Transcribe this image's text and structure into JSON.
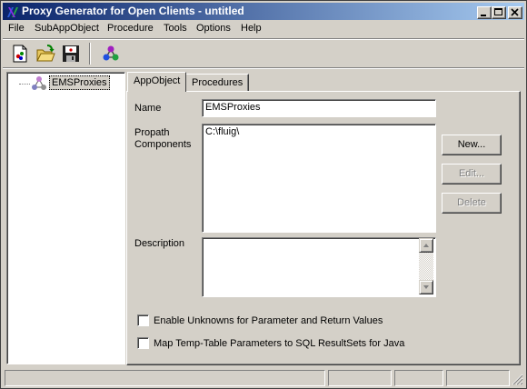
{
  "window": {
    "title": "Proxy Generator for Open Clients - untitled",
    "controls": [
      "minimize",
      "maximize",
      "close"
    ]
  },
  "menu": {
    "items": [
      {
        "label": "File"
      },
      {
        "label": "SubAppObject"
      },
      {
        "label": "Procedure"
      },
      {
        "label": "Tools"
      },
      {
        "label": "Options"
      },
      {
        "label": "Help"
      }
    ]
  },
  "toolbar": {
    "buttons": [
      {
        "icon": "new-document-icon"
      },
      {
        "icon": "open-folder-icon"
      },
      {
        "icon": "save-disk-icon"
      },
      {
        "icon": "generate-proxy-icon"
      }
    ]
  },
  "tree": {
    "root": {
      "label": "EMSProxies",
      "icon": "appobject-node-icon"
    }
  },
  "tabs": [
    {
      "label": "AppObject",
      "active": true
    },
    {
      "label": "Procedures",
      "active": false
    }
  ],
  "form": {
    "name_label": "Name",
    "name_value": "EMSProxies",
    "propath_label_line1": "Propath",
    "propath_label_line2": "Components",
    "propath_value": "C:\\fluig\\",
    "description_label": "Description",
    "description_value": "",
    "new_button": "New...",
    "edit_button": "Edit...",
    "delete_button": "Delete",
    "checkbox_unknowns": {
      "label": "Enable Unknowns for Parameter and Return Values",
      "checked": false
    },
    "checkbox_temptable": {
      "label": "Map Temp-Table Parameters to SQL ResultSets for Java",
      "checked": false
    }
  },
  "status_bar": {
    "panels": [
      "",
      "",
      "",
      ""
    ]
  }
}
